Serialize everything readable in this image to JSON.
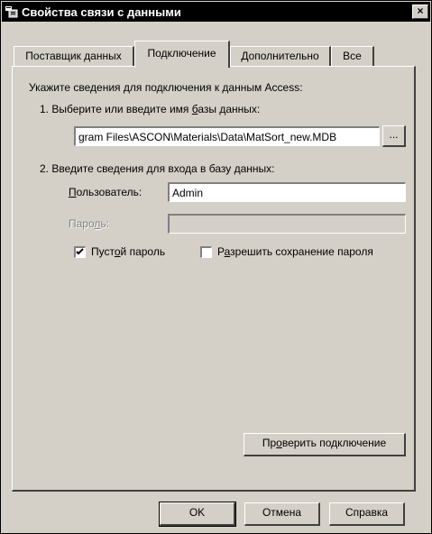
{
  "window": {
    "title": "Свойства связи с данными",
    "close_label": "×"
  },
  "tabs": [
    {
      "label": "Поставщик данных",
      "active": false
    },
    {
      "label": "Подключение",
      "active": true
    },
    {
      "label": "Дополнительно",
      "active": false
    },
    {
      "label": "Все",
      "active": false
    }
  ],
  "connection": {
    "intro": "Укажите сведения для подключения к данным Access:",
    "step1_label_prefix": "1. Выберите или введите имя ",
    "step1_label_ul": "б",
    "step1_label_suffix": "азы данных:",
    "db_path": "gram Files\\ASCON\\Materials\\Data\\MatSort_new.MDB",
    "browse_label": "...",
    "step2_label": "2. Введите сведения для входа в базу данных:",
    "user_label_ul": "П",
    "user_label_rest": "ользователь:",
    "user_value": "Admin",
    "password_label_prefix": "Паро",
    "password_label_ul": "л",
    "password_label_suffix": "ь:",
    "password_value": "",
    "blank_password": {
      "label_prefix": "Пуст",
      "label_ul": "о",
      "label_suffix": "й пароль",
      "checked": true
    },
    "allow_save": {
      "label_prefix": "Р",
      "label_ul": "а",
      "label_suffix": "зрешить сохранение пароля",
      "checked": false
    },
    "test_prefix": "Пр",
    "test_ul": "о",
    "test_suffix": "верить подключение"
  },
  "footer": {
    "ok_label": "OK",
    "cancel_label": "Отмена",
    "help_label": "Справка"
  }
}
